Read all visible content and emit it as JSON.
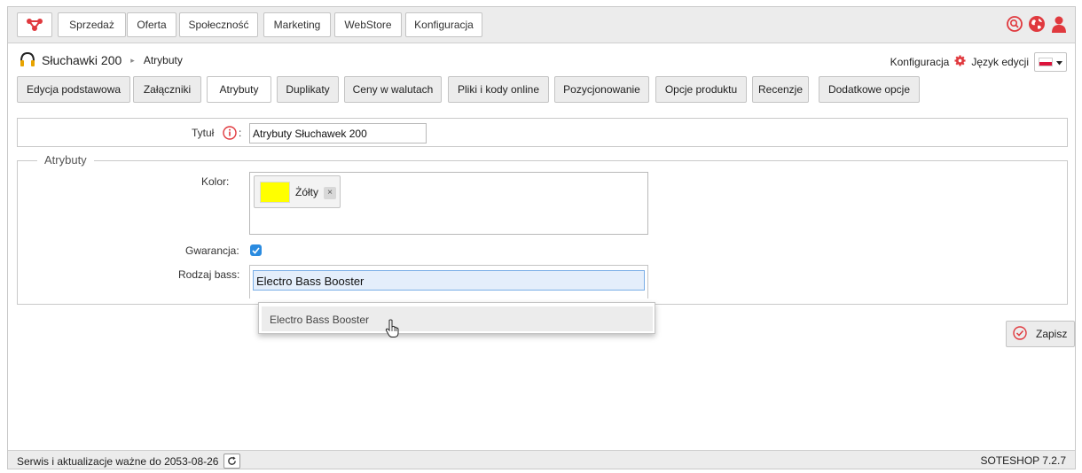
{
  "topbar": {
    "logo": "soteshop-logo-icon",
    "menu": [
      "Sprzedaż",
      "Oferta",
      "Społeczność",
      "Marketing",
      "WebStore",
      "Konfiguracja"
    ],
    "icons": [
      "search-icon",
      "globe-icon",
      "user-icon"
    ],
    "accent_color": "#e0393e"
  },
  "breadcrumb": {
    "product": "Słuchawki 200",
    "current": "Atrybuty",
    "separator": "▸"
  },
  "tools": {
    "config_label": "Konfiguracja",
    "language_label": "Język edycji"
  },
  "tabs": [
    {
      "label": "Edycja podstawowa",
      "active": false
    },
    {
      "label": "Załączniki",
      "active": false
    },
    {
      "label": "Atrybuty",
      "active": true
    },
    {
      "label": "Duplikaty",
      "active": false
    },
    {
      "label": "Ceny w walutach",
      "active": false
    },
    {
      "label": "Pliki i kody online",
      "active": false
    },
    {
      "label": "Pozycjonowanie",
      "active": false
    },
    {
      "label": "Opcje produktu",
      "active": false
    },
    {
      "label": "Recenzje",
      "active": false
    },
    {
      "label": "Dodatkowe opcje",
      "active": false
    }
  ],
  "form": {
    "title_label": "Tytuł",
    "title_colon": ":",
    "title_value": "Atrybuty Słuchawek 200",
    "fieldset_legend": "Atrybuty",
    "color_label": "Kolor:",
    "color_chip": {
      "label": "Żółty",
      "swatch": "#ffff00",
      "remove": "×"
    },
    "warranty_label": "Gwarancja:",
    "warranty_checked": true,
    "bass_label": "Rodzaj bass:",
    "bass_value": "Electro Bass Booster",
    "suggestions": [
      "Electro Bass Booster"
    ]
  },
  "save_label": "Zapisz",
  "footer": {
    "service_text": "Serwis i aktualizacje ważne do 2053-08-26",
    "version": "SOTESHOP 7.2.7"
  }
}
